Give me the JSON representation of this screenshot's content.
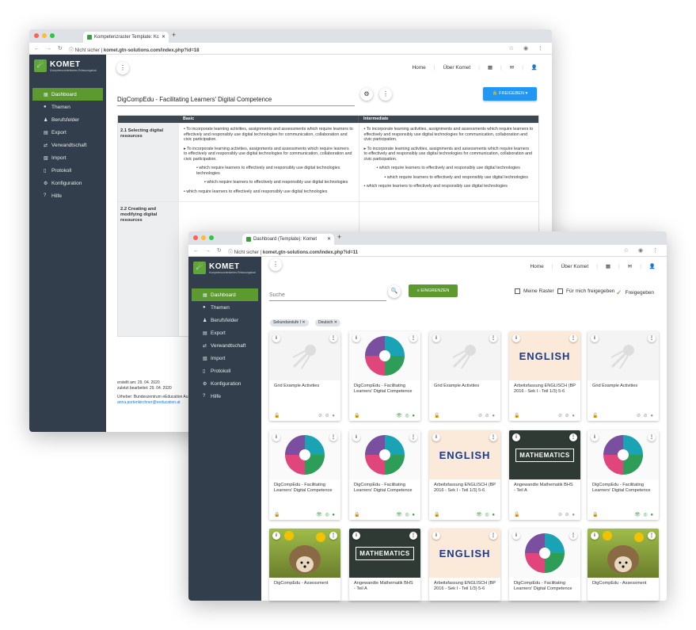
{
  "back": {
    "tab_title": "Kompetenzraster Template: Kc",
    "url_prefix": "Nicht sicher",
    "url": "komet.gtn-solutions.com/index.php?id=18",
    "logo_title": "KOMET",
    "logo_sub": "Kompetenzorientiertes Erfassungstool",
    "nav": {
      "home": "Home",
      "about": "Über Komet"
    },
    "sidebar": [
      {
        "label": "Dashboard",
        "icon": "▦"
      },
      {
        "label": "Themen",
        "icon": "●"
      },
      {
        "label": "Berufsfelder",
        "icon": "♟"
      },
      {
        "label": "Export",
        "icon": "▤"
      },
      {
        "label": "Verwandtschaft",
        "icon": "⇄"
      },
      {
        "label": "Import",
        "icon": "▧"
      },
      {
        "label": "Protokoll",
        "icon": "▯"
      },
      {
        "label": "Konfiguration",
        "icon": "⚙"
      },
      {
        "label": "Hilfe",
        "icon": "?"
      }
    ],
    "grid_title": "DigCompEdu - Facilitating Learners' Digital Competence",
    "share_button": "🔒 FREIGEBEN ▾",
    "columns": [
      "Basic",
      "Intermediate"
    ],
    "rows": [
      {
        "name": "2.1 Selecting digital resources",
        "basic": [
          "To incorporate learning activities, assignments and assessments which require learners to effectively and responsibly use digital technologies for communication, collaboration and civic participation.",
          "To incorporate learning activities, assignments and assessments which require learners to effectively and responsibly use digital technologies for communication, collaboration and civic participation.",
          "which require learners to effectively and responsibly use digital technologies technologies",
          "which require learners to effectively and responsibly use digital technologies",
          "which require learners to effectively and responsibly use digital technologies"
        ],
        "intermediate": [
          "To incorporate learning activities, assignments and assessments which require learners to effectively and responsibly use digital technologies for communication, collaboration and civic participation.",
          "To incorporate learning activities, assignments and assessments which require learners to effectively and responsibly use digital technologies for communication, collaboration and civic participation.",
          "which require learners to effectively and responsibly use digital technologies",
          "which require learners to effectively and responsibly use digital technologies",
          "which require learners to effectively and responsibly use digital technologies"
        ]
      },
      {
        "name": "2.2 Creating and modifying digital resources"
      }
    ],
    "meta": {
      "created": "erstellt am: 29. 04. 2020",
      "edited": "zuletzt bearbeitet: 29. 04. 2020",
      "author": "Urheber: Bundeszentrum eEducation Au",
      "email": "anna.portenkirchner@eeducation.at"
    }
  },
  "front": {
    "tab_title": "Dashboard (Template): Komet",
    "url_prefix": "Nicht sicher",
    "url": "komet.gtn-solutions.com/index.php?id=11",
    "logo_title": "KOMET",
    "logo_sub": "Kompetenzorientiertes Erfassungstool",
    "nav": {
      "home": "Home",
      "about": "Über Komet"
    },
    "sidebar": [
      {
        "label": "Dashboard",
        "icon": "▦"
      },
      {
        "label": "Themen",
        "icon": "●"
      },
      {
        "label": "Berufsfelder",
        "icon": "♟"
      },
      {
        "label": "Export",
        "icon": "▤"
      },
      {
        "label": "Verwandtschaft",
        "icon": "⇄"
      },
      {
        "label": "Import",
        "icon": "▧"
      },
      {
        "label": "Protokoll",
        "icon": "▯"
      },
      {
        "label": "Konfiguration",
        "icon": "⚙"
      },
      {
        "label": "Hilfe",
        "icon": "?"
      }
    ],
    "search_placeholder": "Suche",
    "filter_button": "≡ EINGRENZEN",
    "checks": {
      "mine": "Meine Raster",
      "shared_me": "Für mich freigegeben",
      "shared": "Freigegeben"
    },
    "chips": [
      "Sekundarstufe I",
      "Deutsch"
    ],
    "cards": [
      {
        "title": "Grid Example Activities",
        "image": "blank",
        "locked": false
      },
      {
        "title": "DigCompEdu - Facilitating Learners' Digital Competence",
        "image": "wheel",
        "locked": true
      },
      {
        "title": "Grid Example Activities",
        "image": "blank",
        "locked": false
      },
      {
        "title": "Arbeitsfassung ENGLISCH (BP 2016 - Sek I - Teil 1/3) 5-6",
        "image": "english",
        "locked": false
      },
      {
        "title": "Grid Example Activities",
        "image": "blank",
        "locked": false
      },
      {
        "title": "DigCompEdu - Facilitating Learners' Digital Competence",
        "image": "wheel",
        "locked": true
      },
      {
        "title": "DigCompEdu - Facilitating Learners' Digital Competence",
        "image": "wheel",
        "locked": true
      },
      {
        "title": "Arbeitsfassung ENGLISCH (BP 2016 - Sek I - Teil 1/3) 5-6",
        "image": "english",
        "locked": true
      },
      {
        "title": "Angewandte Mathematik BHS - Teil A",
        "image": "math",
        "locked": false
      },
      {
        "title": "DigCompEdu - Facilitating Learners' Digital Competence",
        "image": "wheel",
        "locked": true
      },
      {
        "title": "DigCompEdu - Assessment",
        "image": "hedge",
        "locked": false
      },
      {
        "title": "Angewandte Mathematik BHS - Teil A",
        "image": "math",
        "locked": false
      },
      {
        "title": "Arbeitsfassung ENGLISCH (BP 2016 - Sek I - Teil 1/3) 5-6",
        "image": "english",
        "locked": false
      },
      {
        "title": "DigCompEdu - Facilitating Learners' Digital Competence",
        "image": "wheel",
        "locked": false
      },
      {
        "title": "DigCompEdu - Assessment",
        "image": "hedge",
        "locked": false
      }
    ],
    "image_words": {
      "english": "ENGLISH",
      "math": "MATHEMATICS"
    }
  }
}
